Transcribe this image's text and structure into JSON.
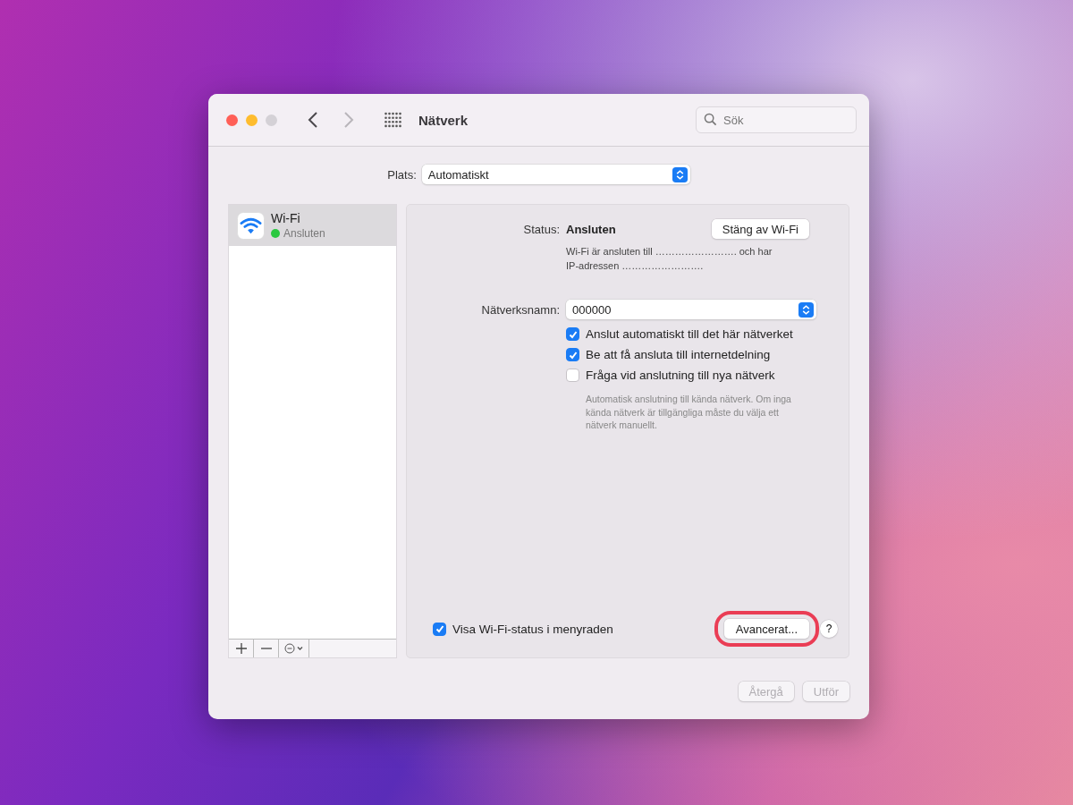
{
  "window": {
    "title": "Nätverk",
    "search": {
      "placeholder": "Sök"
    },
    "traffic_lights": [
      {
        "kind": "close",
        "disabled": false
      },
      {
        "kind": "minimize",
        "disabled": false
      },
      {
        "kind": "zoom",
        "disabled": true
      }
    ],
    "nav": {
      "back_disabled": false,
      "forward_disabled": true
    }
  },
  "location": {
    "label": "Plats:",
    "value": "Automatiskt"
  },
  "services": [
    {
      "name": "Wi-Fi",
      "status": "Ansluten",
      "color": "#2ac840",
      "selected": true
    }
  ],
  "list_toolbar": [
    {
      "kind": "add"
    },
    {
      "kind": "remove"
    },
    {
      "kind": "action"
    }
  ],
  "detail": {
    "status_label": "Status:",
    "status_value": "Ansluten",
    "toggle_button": "Stäng av Wi-Fi",
    "description": "Wi-Fi är ansluten till ……………………. och har IP-adressen …………………….",
    "network_label": "Nätverksnamn:",
    "network_value": "000000",
    "options": [
      {
        "label": "Anslut automatiskt till det här nätverket",
        "checked": true
      },
      {
        "label": "Be att få ansluta till internetdelning",
        "checked": true
      },
      {
        "label": "Fråga vid anslutning till nya nätverk",
        "checked": false
      }
    ],
    "hint": "Automatisk anslutning till kända nätverk. Om inga kända nätverk är tillgängliga måste du välja ett nätverk manuellt.",
    "menubar_option": {
      "label": "Visa Wi-Fi-status i menyraden",
      "checked": true
    },
    "advanced_button": {
      "label": "Avancerat...",
      "highlighted": true
    },
    "help": "?"
  },
  "footer_buttons": [
    {
      "label": "Återgå",
      "disabled": true
    },
    {
      "label": "Utför",
      "disabled": true
    }
  ]
}
